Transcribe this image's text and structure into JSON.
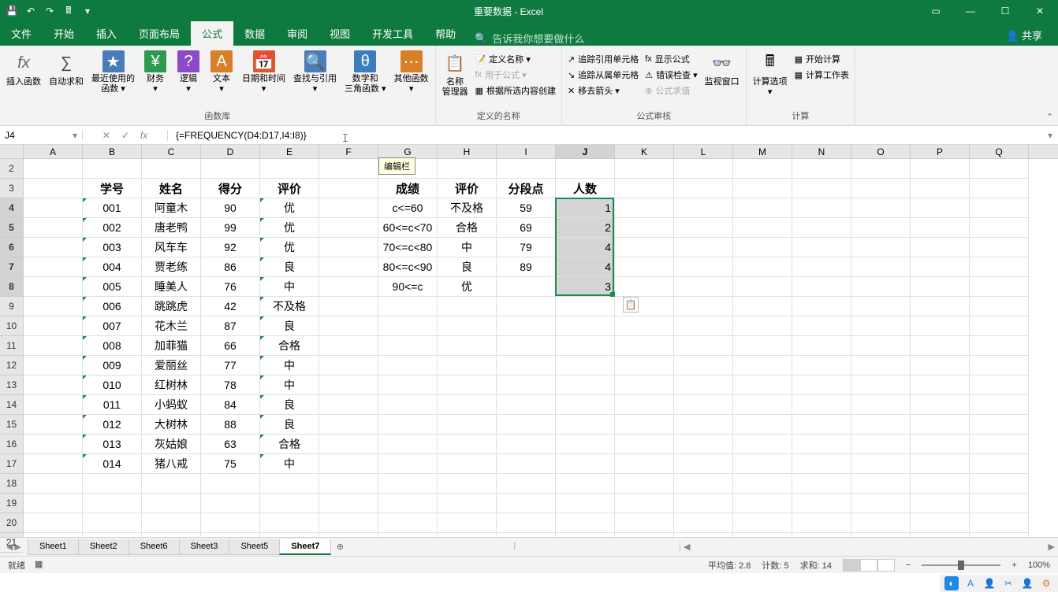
{
  "title": "重要数据 - Excel",
  "menu": {
    "file": "文件",
    "home": "开始",
    "insert": "插入",
    "layout": "页面布局",
    "formulas": "公式",
    "data": "数据",
    "review": "审阅",
    "view": "视图",
    "dev": "开发工具",
    "help": "帮助",
    "tellme_placeholder": "告诉我你想要做什么",
    "share": "共享"
  },
  "ribbon": {
    "groups": {
      "func_lib": "函数库",
      "def_names": "定义的名称",
      "formula_audit": "公式审核",
      "calc": "计算"
    },
    "buttons": {
      "insert_fn": "插入函数",
      "autosum": "自动求和",
      "recent": "最近使用的\n函数 ▾",
      "financial": "财务\n▾",
      "logical": "逻辑\n▾",
      "text": "文本\n▾",
      "datetime": "日期和时间\n▾",
      "lookup": "查找与引用\n▾",
      "math": "数学和\n三角函数 ▾",
      "more": "其他函数\n▾",
      "name_mgr": "名称\n管理器",
      "define_name": "定义名称 ▾",
      "use_formula": "用于公式 ▾",
      "from_selection": "根据所选内容创建",
      "trace_prec": "追踪引用单元格",
      "trace_dep": "追踪从属单元格",
      "remove_arrows": "移去箭头 ▾",
      "show_formulas": "显示公式",
      "error_check": "错误检查 ▾",
      "eval": "公式求值",
      "watch": "监视窗口",
      "calc_options": "计算选项\n▾",
      "calc_now": "开始计算",
      "calc_sheet": "计算工作表"
    }
  },
  "name_box": "J4",
  "formula": "{=FREQUENCY(D4:D17,I4:I8)}",
  "tooltip": "编辑栏",
  "columns": [
    "A",
    "B",
    "C",
    "D",
    "E",
    "F",
    "G",
    "H",
    "I",
    "J",
    "K",
    "L",
    "M",
    "N",
    "O",
    "P",
    "Q"
  ],
  "rows_visible": [
    2,
    3,
    4,
    5,
    6,
    7,
    8,
    9,
    10,
    11,
    12,
    13,
    14,
    15,
    16,
    17,
    18,
    19,
    20,
    21
  ],
  "headers": {
    "B": "学号",
    "C": "姓名",
    "D": "得分",
    "E": "评价",
    "G": "成绩",
    "H": "评价",
    "I": "分段点",
    "J": "人数"
  },
  "table1": [
    {
      "id": "001",
      "name": "阿童木",
      "score": "90",
      "grade": "优"
    },
    {
      "id": "002",
      "name": "唐老鸭",
      "score": "99",
      "grade": "优"
    },
    {
      "id": "003",
      "name": "风车车",
      "score": "92",
      "grade": "优"
    },
    {
      "id": "004",
      "name": "贾老练",
      "score": "86",
      "grade": "良"
    },
    {
      "id": "005",
      "name": "睡美人",
      "score": "76",
      "grade": "中"
    },
    {
      "id": "006",
      "name": "跳跳虎",
      "score": "42",
      "grade": "不及格"
    },
    {
      "id": "007",
      "name": "花木兰",
      "score": "87",
      "grade": "良"
    },
    {
      "id": "008",
      "name": "加菲猫",
      "score": "66",
      "grade": "合格"
    },
    {
      "id": "009",
      "name": "爱丽丝",
      "score": "77",
      "grade": "中"
    },
    {
      "id": "010",
      "name": "红树林",
      "score": "78",
      "grade": "中"
    },
    {
      "id": "011",
      "name": "小蚂蚁",
      "score": "84",
      "grade": "良"
    },
    {
      "id": "012",
      "name": "大树林",
      "score": "88",
      "grade": "良"
    },
    {
      "id": "013",
      "name": "灰姑娘",
      "score": "63",
      "grade": "合格"
    },
    {
      "id": "014",
      "name": "猪八戒",
      "score": "75",
      "grade": "中"
    }
  ],
  "table2": [
    {
      "range": "c<=60",
      "grade": "不及格",
      "cut": "59",
      "count": "1"
    },
    {
      "range": "60<=c<70",
      "grade": "合格",
      "cut": "69",
      "count": "2"
    },
    {
      "range": "70<=c<80",
      "grade": "中",
      "cut": "79",
      "count": "4"
    },
    {
      "range": "80<=c<90",
      "grade": "良",
      "cut": "89",
      "count": "4"
    },
    {
      "range": "90<=c",
      "grade": "优",
      "cut": "",
      "count": "3"
    }
  ],
  "sheets": [
    "Sheet1",
    "Sheet2",
    "Sheet6",
    "Sheet3",
    "Sheet5",
    "Sheet7"
  ],
  "active_sheet": "Sheet7",
  "status": {
    "ready": "就绪",
    "avg": "平均值: 2.8",
    "count": "计数: 5",
    "sum": "求和: 14",
    "zoom": "100%"
  }
}
